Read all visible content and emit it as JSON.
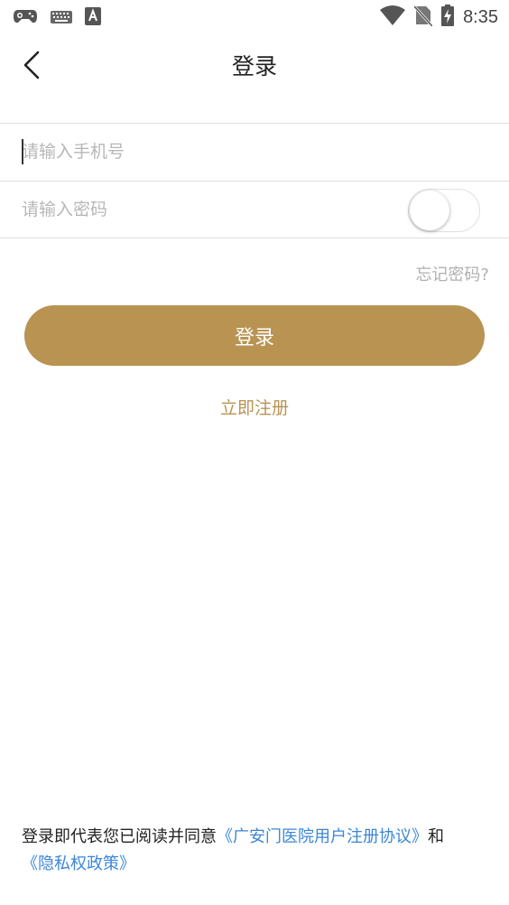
{
  "status_bar": {
    "time": "8:35",
    "icons": [
      "gamepad-icon",
      "keyboard-icon",
      "font-icon",
      "wifi-icon",
      "no-sim-icon",
      "battery-charging-icon"
    ]
  },
  "nav": {
    "title": "登录",
    "back_icon": "chevron-left-icon"
  },
  "form": {
    "phone_placeholder": "请输入手机号",
    "phone_value": "",
    "password_placeholder": "请输入密码",
    "password_value": "",
    "password_toggle_on": false,
    "forgot_label": "忘记密码?",
    "login_label": "登录",
    "register_label": "立即注册"
  },
  "agreement": {
    "prefix": "登录即代表您已阅读并同意",
    "user_agreement": "《广安门医院用户注册协议》",
    "and": "和",
    "privacy_policy": "《隐私权政策》"
  },
  "colors": {
    "accent": "#b89352",
    "link": "#3b86d8",
    "placeholder": "#b7b7b7"
  }
}
